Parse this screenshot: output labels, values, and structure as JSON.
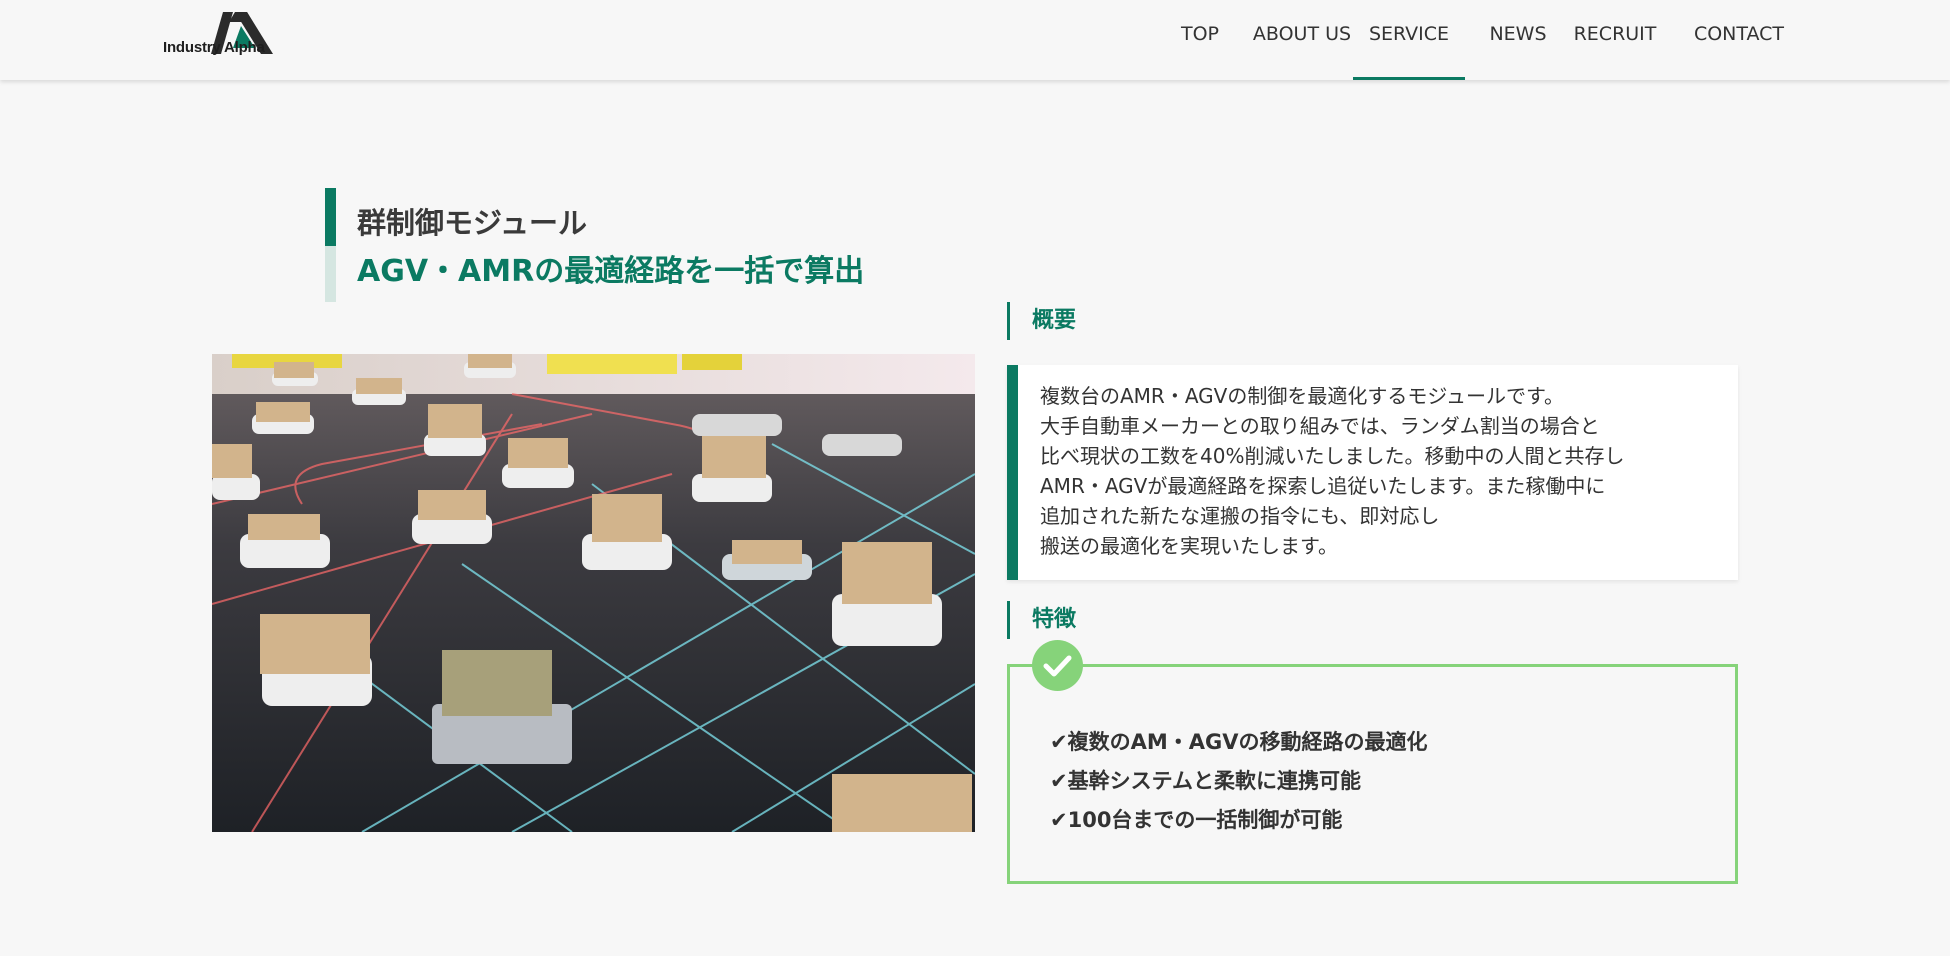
{
  "header": {
    "logo_text": "Industry Alpha",
    "nav": [
      {
        "label": "TOP",
        "active": false
      },
      {
        "label": "ABOUT US",
        "active": false
      },
      {
        "label": "SERVICE",
        "active": true
      },
      {
        "label": "NEWS",
        "active": false
      },
      {
        "label": "RECRUIT",
        "active": false
      },
      {
        "label": "CONTACT",
        "active": false
      }
    ]
  },
  "hero": {
    "title": "群制御モジュール",
    "subtitle": "AGV・AMRの最適経路を一括で算出",
    "image_icon": "agv-warehouse-photo"
  },
  "overview": {
    "heading": "概要",
    "lines": [
      "複数台のAMR・AGVの制御を最適化するモジュールです。",
      "大手自動車メーカーとの取り組みでは、ランダム割当の場合と",
      "比べ現状の工数を40%削減いたしました。移動中の人間と共存し",
      "AMR・AGVが最適経路を探索し追従いたします。また稼働中に",
      "追加された新たな運搬の指令にも、即対応し",
      "搬送の最適化を実現いたします。"
    ]
  },
  "features": {
    "heading": "特徴",
    "badge_icon": "checkmark-icon",
    "items": [
      "✔複数のAM・AGVの移動経路の最適化",
      "✔基幹システムと柔軟に連携可能",
      "✔100台までの一括制御が可能"
    ]
  },
  "colors": {
    "brand_green": "#0b7a62",
    "light_green": "#86d37a",
    "background": "#f7f7f7"
  }
}
